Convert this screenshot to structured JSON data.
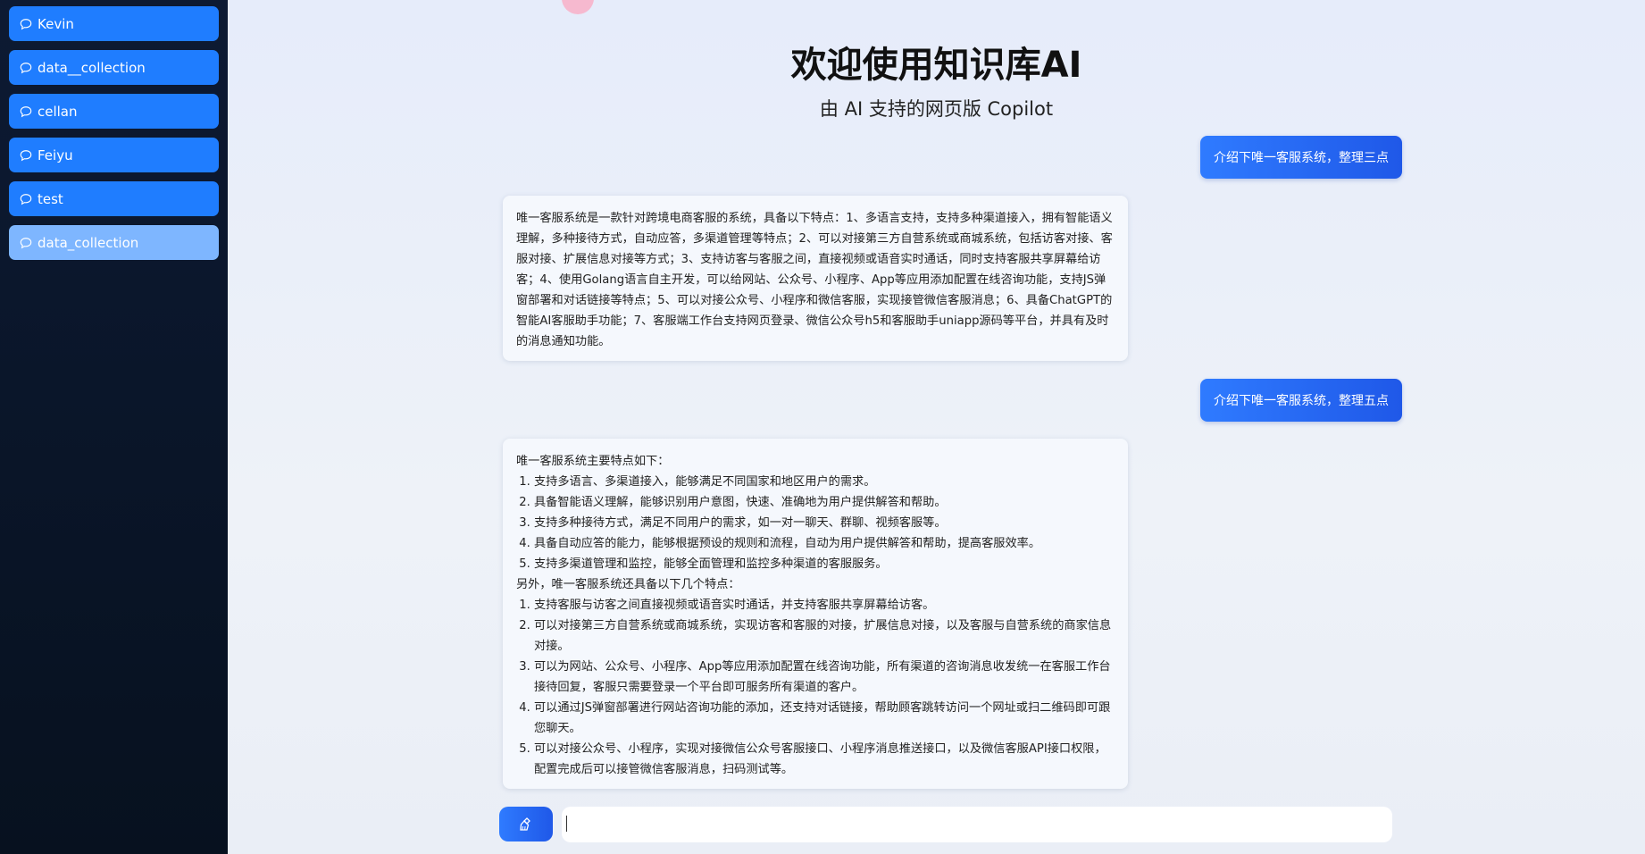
{
  "sidebar": {
    "items": [
      {
        "label": "Kevin"
      },
      {
        "label": "data__collection"
      },
      {
        "label": "cellan"
      },
      {
        "label": "Feiyu"
      },
      {
        "label": "test"
      },
      {
        "label": "data_collection"
      }
    ],
    "active_index": 5
  },
  "header": {
    "title": "欢迎使用知识库AI",
    "subtitle": "由 AI 支持的网页版 Copilot"
  },
  "messages": {
    "user1": "介绍下唯一客服系统，整理三点",
    "ai1": "唯一客服系统是一款针对跨境电商客服的系统，具备以下特点：1、多语言支持，支持多种渠道接入，拥有智能语义理解，多种接待方式，自动应答，多渠道管理等特点；2、可以对接第三方自营系统或商城系统，包括访客对接、客服对接、扩展信息对接等方式；3、支持访客与客服之间，直接视频或语音实时通话，同时支持客服共享屏幕给访客；4、使用Golang语言自主开发，可以给网站、公众号、小程序、App等应用添加配置在线咨询功能，支持JS弹窗部署和对话链接等特点；5、可以对接公众号、小程序和微信客服，实现接管微信客服消息；6、具备ChatGPT的智能AI客服助手功能；7、客服端工作台支持网页登录、微信公众号h5和客服助手uniapp源码等平台，并具有及时的消息通知功能。",
    "user2": "介绍下唯一客服系统，整理五点",
    "ai2": {
      "intro": "唯一客服系统主要特点如下：",
      "list1": [
        "支持多语言、多渠道接入，能够满足不同国家和地区用户的需求。",
        "具备智能语义理解，能够识别用户意图，快速、准确地为用户提供解答和帮助。",
        "支持多种接待方式，满足不同用户的需求，如一对一聊天、群聊、视频客服等。",
        "具备自动应答的能力，能够根据预设的规则和流程，自动为用户提供解答和帮助，提高客服效率。",
        "支持多渠道管理和监控，能够全面管理和监控多种渠道的客服服务。"
      ],
      "middle": "另外，唯一客服系统还具备以下几个特点：",
      "list2": [
        "支持客服与访客之间直接视频或语音实时通话，并支持客服共享屏幕给访客。",
        "可以对接第三方自营系统或商城系统，实现访客和客服的对接，扩展信息对接，以及客服与自营系统的商家信息对接。",
        "可以为网站、公众号、小程序、App等应用添加配置在线咨询功能，所有渠道的咨询消息收发统一在客服工作台接待回复，客服只需要登录一个平台即可服务所有渠道的客户。",
        "可以通过JS弹窗部署进行网站咨询功能的添加，还支持对话链接，帮助顾客跳转访问一个网址或扫二维码即可跟您聊天。",
        "可以对接公众号、小程序，实现对接微信公众号客服接口、小程序消息推送接口，以及微信客服API接口权限，配置完成后可以接管微信客服消息，扫码测试等。"
      ]
    }
  },
  "input": {
    "value": "",
    "placeholder": ""
  },
  "icons": {
    "conversation": "chat-bubble-icon",
    "clear": "broom-icon",
    "avatar": "avatar-icon"
  },
  "colors": {
    "accent": "#1f7dff",
    "active_item": "#7eb6ff",
    "sidebar_bg": "#0d1a33"
  }
}
